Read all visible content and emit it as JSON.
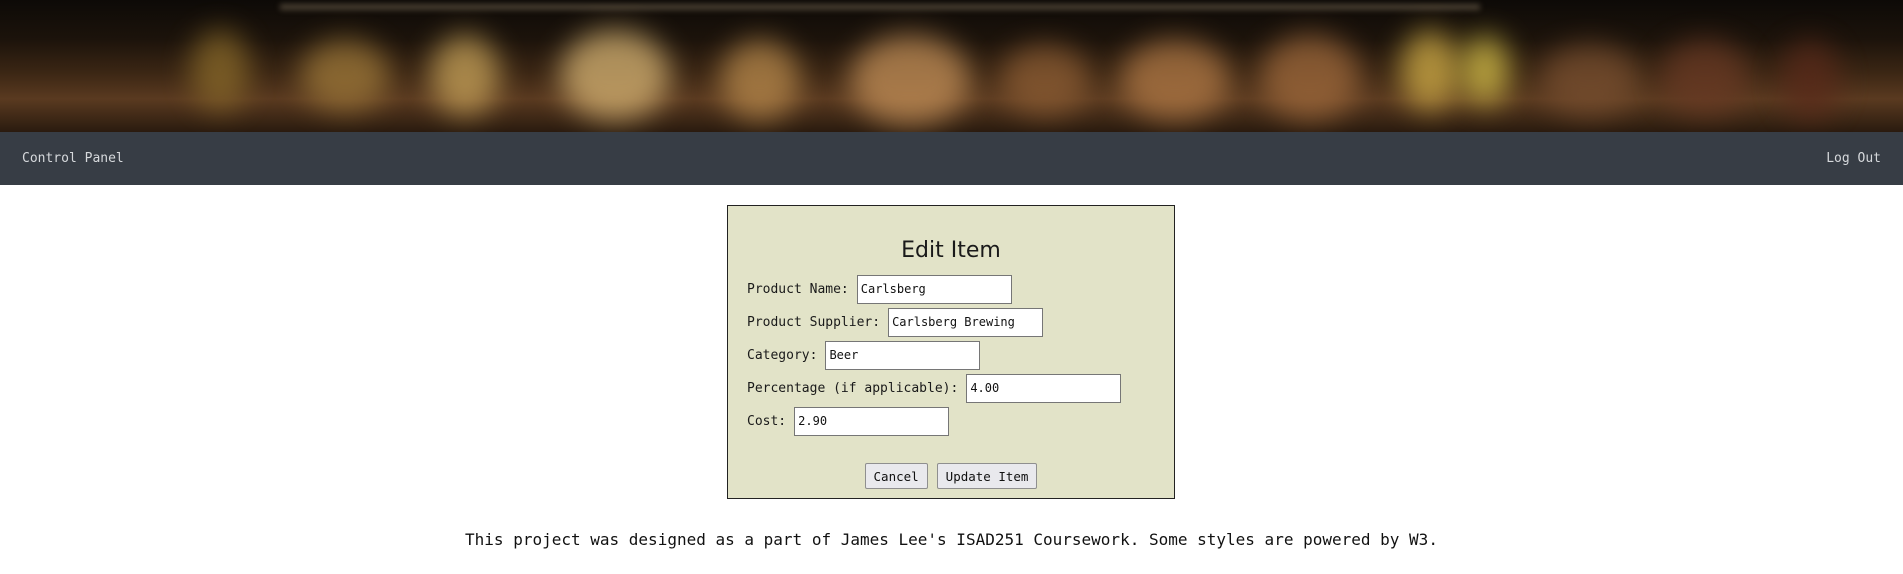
{
  "nav": {
    "left_label": "Control Panel",
    "right_label": "Log Out"
  },
  "form": {
    "title": "Edit Item",
    "fields": [
      {
        "label": "Product Name:",
        "value": "Carlsberg"
      },
      {
        "label": "Product Supplier:",
        "value": "Carlsberg Brewing"
      },
      {
        "label": "Category:",
        "value": "Beer"
      },
      {
        "label": "Percentage (if applicable):",
        "value": "4.00"
      },
      {
        "label": "Cost:",
        "value": "2.90"
      }
    ],
    "cancel_label": "Cancel",
    "submit_label": "Update Item"
  },
  "footer": {
    "text": "This project was designed as a part of James Lee's ISAD251 Coursework. Some styles are powered by W3."
  },
  "colors": {
    "navbar": "#373d45",
    "panel": "#e2e3c8",
    "nav_text": "#d6d9dc"
  }
}
